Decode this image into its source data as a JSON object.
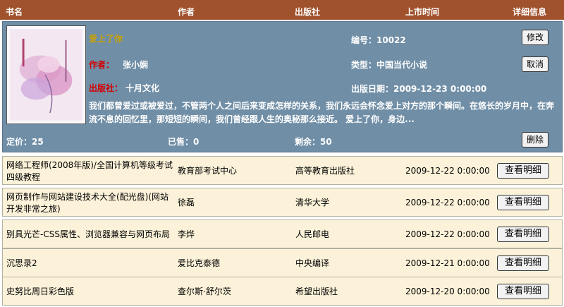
{
  "header": {
    "col_title": "书名",
    "col_author": "作者",
    "col_publisher": "出版社",
    "col_date": "上市时间",
    "col_detail": "详细信息"
  },
  "detail": {
    "title": "爱上了你",
    "author_label": "作者：",
    "author_value": "张小娴",
    "publisher_label": "出版社：",
    "publisher_value": "十月文化",
    "id_text": "编号：10022",
    "type_text": "类型：中国当代小说",
    "date_text": "出版日期：2009-12-23 0:00:00",
    "description": "我们都曾爱过或被爱过，不管两个人之间后来变成怎样的关系，我们永远会怀念爱上对方的那个瞬间。在悠长的岁月中，在奔流不息的回忆里，那短短的瞬间，我们曾经跟人生的奥秘那么接近。  爱上了你，身边...",
    "price_text": "定价：25",
    "sold_text": "已售：0",
    "remaining_text": "剩余：50",
    "edit_button": "修改",
    "cancel_button": "取消",
    "delete_button": "删除"
  },
  "rows": [
    {
      "title": "网络工程师(2008年版)/全国计算机等级考试四级教程",
      "author": "教育部考试中心",
      "publisher": "高等教育出版社",
      "date": "2009-12-22 0:00:00",
      "button": "查看明细"
    },
    {
      "title": "网页制作与网站建设技术大全(配光盘)(网站开发非常之旅)",
      "author": "徐磊",
      "publisher": "清华大学",
      "date": "2009-12-22 0:00:00",
      "button": "查看明细"
    },
    {
      "title": "别具光芒-CSS属性、浏览器兼容与网页布局",
      "author": "李烨",
      "publisher": "人民邮电",
      "date": "2009-12-22 0:00:00",
      "button": "查看明细"
    },
    {
      "title": "沉思录2",
      "author": "爱比克泰德",
      "publisher": "中央编译",
      "date": "2009-12-21 0:00:00",
      "button": "查看明细"
    },
    {
      "title": "史努比周日彩色版",
      "author": "查尔斯·舒尔茨",
      "publisher": "希望出版社",
      "date": "2009-12-20 0:00:00",
      "button": "查看明细"
    }
  ],
  "colors": {
    "header_bg": "#a0522d",
    "detail_bg": "#708ea6",
    "row_bg": "#fbf2d9",
    "title_color": "#c8a200",
    "label_red": "#d40000"
  }
}
